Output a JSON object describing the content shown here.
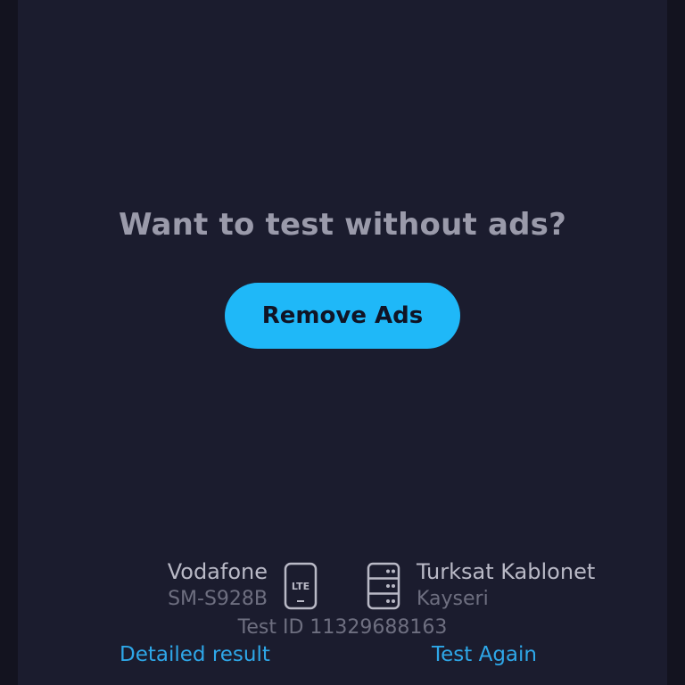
{
  "promo": {
    "headline": "Want to test without ads?",
    "button_label": "Remove Ads"
  },
  "client": {
    "provider": "Vodafone",
    "device": "SM-S928B",
    "connection_type": "LTE",
    "connection_icon": "phone-lte-icon"
  },
  "server": {
    "isp": "Turksat Kablonet",
    "city": "Kayseri",
    "icon": "server-icon"
  },
  "test": {
    "id_label": "Test ID 11329688163"
  },
  "actions": {
    "detailed_label": "Detailed result",
    "again_label": "Test Again"
  },
  "colors": {
    "background": "#1b1c2e",
    "accent": "#1fb8f8",
    "link": "#2ea7e8",
    "primary_text": "#b9b9c6",
    "secondary_text": "#6e6f80"
  }
}
